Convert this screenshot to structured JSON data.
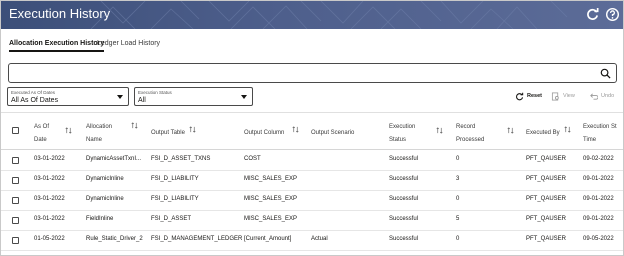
{
  "header": {
    "title": "Execution History",
    "colors": {
      "start": "#3c4f79",
      "end": "#5c6c98"
    },
    "icons": {
      "refresh": "refresh-icon",
      "help": "help-icon"
    }
  },
  "tabs": [
    {
      "label": "Allocation Execution History",
      "active": true
    },
    {
      "label": "Ledger Load History",
      "active": false
    }
  ],
  "search": {
    "value": "",
    "placeholder": ""
  },
  "filters": {
    "date": {
      "label": "Executed As Of Dates",
      "value": "All As Of Dates"
    },
    "status": {
      "label": "Execution Status",
      "value": "All"
    }
  },
  "toolbar": {
    "reset": "Reset",
    "view": "View",
    "undo": "Undo"
  },
  "table": {
    "columns": [
      [
        "As Of",
        "Date"
      ],
      [
        "Allocation",
        "Name"
      ],
      [
        "Output Table"
      ],
      [
        "Output Column"
      ],
      [
        "Output Scenario"
      ],
      [
        "Execution",
        "Status"
      ],
      [
        "Record",
        "Processed"
      ],
      [
        "Executed By"
      ],
      [
        "Execution St",
        "Time"
      ]
    ],
    "rows": [
      [
        "03-01-2022",
        "DynamicAssetTxnI...",
        "FSI_D_ASSET_TXNS",
        "COST",
        "",
        "Successful",
        "0",
        "PFT_QAUSER",
        "09-02-2022"
      ],
      [
        "03-01-2022",
        "DynamicInline",
        "FSI_D_LIABILITY",
        "MISC_SALES_EXP",
        "",
        "Successful",
        "3",
        "PFT_QAUSER",
        "09-01-2022"
      ],
      [
        "03-01-2022",
        "DynamicInline",
        "FSI_D_LIABILITY",
        "MISC_SALES_EXP",
        "",
        "Successful",
        "0",
        "PFT_QAUSER",
        "09-01-2022"
      ],
      [
        "03-01-2022",
        "FieldInline",
        "FSI_D_ASSET",
        "MISC_SALES_EXP",
        "",
        "Successful",
        "5",
        "PFT_QAUSER",
        "09-01-2022"
      ],
      [
        "01-05-2022",
        "Rule_Static_Driver_2",
        "FSI_D_MANAGEMENT_LEDGER",
        "[Current_Amount]",
        "Actual",
        "Successful",
        "0",
        "PFT_QAUSER",
        "09-05-2022"
      ]
    ]
  }
}
